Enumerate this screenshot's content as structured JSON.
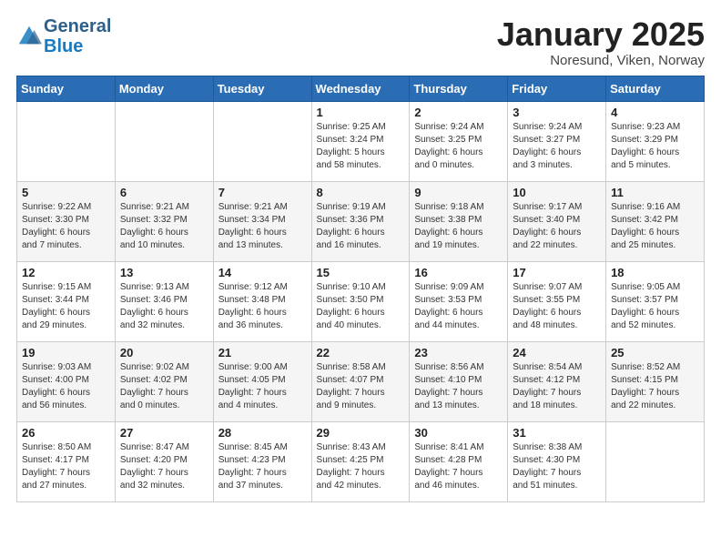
{
  "header": {
    "logo_general": "General",
    "logo_blue": "Blue",
    "month_title": "January 2025",
    "location": "Noresund, Viken, Norway"
  },
  "weekdays": [
    "Sunday",
    "Monday",
    "Tuesday",
    "Wednesday",
    "Thursday",
    "Friday",
    "Saturday"
  ],
  "weeks": [
    [
      {
        "day": "",
        "info": ""
      },
      {
        "day": "",
        "info": ""
      },
      {
        "day": "",
        "info": ""
      },
      {
        "day": "1",
        "info": "Sunrise: 9:25 AM\nSunset: 3:24 PM\nDaylight: 5 hours\nand 58 minutes."
      },
      {
        "day": "2",
        "info": "Sunrise: 9:24 AM\nSunset: 3:25 PM\nDaylight: 6 hours\nand 0 minutes."
      },
      {
        "day": "3",
        "info": "Sunrise: 9:24 AM\nSunset: 3:27 PM\nDaylight: 6 hours\nand 3 minutes."
      },
      {
        "day": "4",
        "info": "Sunrise: 9:23 AM\nSunset: 3:29 PM\nDaylight: 6 hours\nand 5 minutes."
      }
    ],
    [
      {
        "day": "5",
        "info": "Sunrise: 9:22 AM\nSunset: 3:30 PM\nDaylight: 6 hours\nand 7 minutes."
      },
      {
        "day": "6",
        "info": "Sunrise: 9:21 AM\nSunset: 3:32 PM\nDaylight: 6 hours\nand 10 minutes."
      },
      {
        "day": "7",
        "info": "Sunrise: 9:21 AM\nSunset: 3:34 PM\nDaylight: 6 hours\nand 13 minutes."
      },
      {
        "day": "8",
        "info": "Sunrise: 9:19 AM\nSunset: 3:36 PM\nDaylight: 6 hours\nand 16 minutes."
      },
      {
        "day": "9",
        "info": "Sunrise: 9:18 AM\nSunset: 3:38 PM\nDaylight: 6 hours\nand 19 minutes."
      },
      {
        "day": "10",
        "info": "Sunrise: 9:17 AM\nSunset: 3:40 PM\nDaylight: 6 hours\nand 22 minutes."
      },
      {
        "day": "11",
        "info": "Sunrise: 9:16 AM\nSunset: 3:42 PM\nDaylight: 6 hours\nand 25 minutes."
      }
    ],
    [
      {
        "day": "12",
        "info": "Sunrise: 9:15 AM\nSunset: 3:44 PM\nDaylight: 6 hours\nand 29 minutes."
      },
      {
        "day": "13",
        "info": "Sunrise: 9:13 AM\nSunset: 3:46 PM\nDaylight: 6 hours\nand 32 minutes."
      },
      {
        "day": "14",
        "info": "Sunrise: 9:12 AM\nSunset: 3:48 PM\nDaylight: 6 hours\nand 36 minutes."
      },
      {
        "day": "15",
        "info": "Sunrise: 9:10 AM\nSunset: 3:50 PM\nDaylight: 6 hours\nand 40 minutes."
      },
      {
        "day": "16",
        "info": "Sunrise: 9:09 AM\nSunset: 3:53 PM\nDaylight: 6 hours\nand 44 minutes."
      },
      {
        "day": "17",
        "info": "Sunrise: 9:07 AM\nSunset: 3:55 PM\nDaylight: 6 hours\nand 48 minutes."
      },
      {
        "day": "18",
        "info": "Sunrise: 9:05 AM\nSunset: 3:57 PM\nDaylight: 6 hours\nand 52 minutes."
      }
    ],
    [
      {
        "day": "19",
        "info": "Sunrise: 9:03 AM\nSunset: 4:00 PM\nDaylight: 6 hours\nand 56 minutes."
      },
      {
        "day": "20",
        "info": "Sunrise: 9:02 AM\nSunset: 4:02 PM\nDaylight: 7 hours\nand 0 minutes."
      },
      {
        "day": "21",
        "info": "Sunrise: 9:00 AM\nSunset: 4:05 PM\nDaylight: 7 hours\nand 4 minutes."
      },
      {
        "day": "22",
        "info": "Sunrise: 8:58 AM\nSunset: 4:07 PM\nDaylight: 7 hours\nand 9 minutes."
      },
      {
        "day": "23",
        "info": "Sunrise: 8:56 AM\nSunset: 4:10 PM\nDaylight: 7 hours\nand 13 minutes."
      },
      {
        "day": "24",
        "info": "Sunrise: 8:54 AM\nSunset: 4:12 PM\nDaylight: 7 hours\nand 18 minutes."
      },
      {
        "day": "25",
        "info": "Sunrise: 8:52 AM\nSunset: 4:15 PM\nDaylight: 7 hours\nand 22 minutes."
      }
    ],
    [
      {
        "day": "26",
        "info": "Sunrise: 8:50 AM\nSunset: 4:17 PM\nDaylight: 7 hours\nand 27 minutes."
      },
      {
        "day": "27",
        "info": "Sunrise: 8:47 AM\nSunset: 4:20 PM\nDaylight: 7 hours\nand 32 minutes."
      },
      {
        "day": "28",
        "info": "Sunrise: 8:45 AM\nSunset: 4:23 PM\nDaylight: 7 hours\nand 37 minutes."
      },
      {
        "day": "29",
        "info": "Sunrise: 8:43 AM\nSunset: 4:25 PM\nDaylight: 7 hours\nand 42 minutes."
      },
      {
        "day": "30",
        "info": "Sunrise: 8:41 AM\nSunset: 4:28 PM\nDaylight: 7 hours\nand 46 minutes."
      },
      {
        "day": "31",
        "info": "Sunrise: 8:38 AM\nSunset: 4:30 PM\nDaylight: 7 hours\nand 51 minutes."
      },
      {
        "day": "",
        "info": ""
      }
    ]
  ]
}
